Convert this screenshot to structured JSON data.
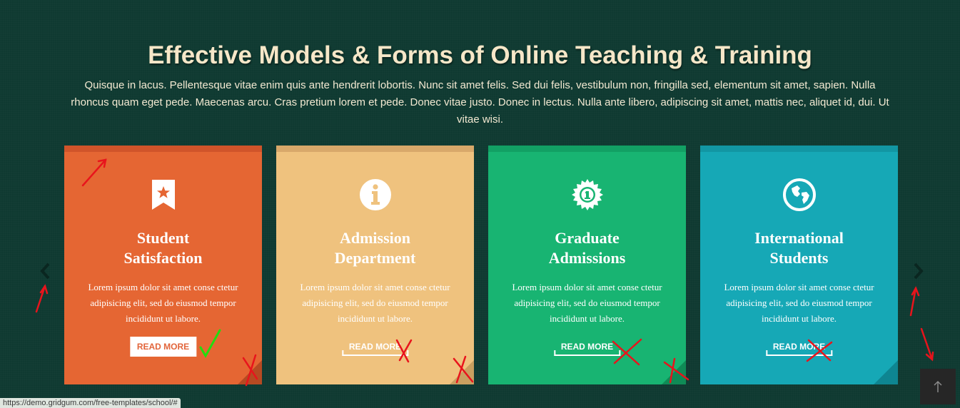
{
  "section": {
    "heading": "Effective Models & Forms of Online Teaching & Training",
    "intro": "Quisque in lacus. Pellentesque vitae enim quis ante hendrerit lobortis. Nunc sit amet felis. Sed dui felis, vestibulum non, fringilla sed, elementum sit amet, sapien. Nulla rhoncus quam eget pede. Maecenas arcu. Cras pretium lorem et pede. Donec vitae justo. Donec in lectus. Nulla ante libero, adipiscing sit amet, mattis nec, aliquet id, dui. Ut vitae wisi."
  },
  "cards": [
    {
      "title_line1": "Student",
      "title_line2": "Satisfaction",
      "desc": "Lorem ipsum dolor sit amet conse ctetur adipisicing elit, sed do eiusmod tempor incididunt ut labore.",
      "button": "READ MORE",
      "icon": "bookmark-star-icon",
      "color": "#e56633",
      "bar_color": "#d0542a"
    },
    {
      "title_line1": "Admission",
      "title_line2": "Department",
      "desc": "Lorem ipsum dolor sit amet conse ctetur adipisicing elit, sed do eiusmod tempor incididunt ut labore.",
      "button": "READ MORE",
      "icon": "info-icon",
      "color": "#efc27e",
      "bar_color": "#d8a86a"
    },
    {
      "title_line1": "Graduate",
      "title_line2": "Admissions",
      "desc": "Lorem ipsum dolor sit amet conse ctetur adipisicing elit, sed do eiusmod tempor incididunt ut labore.",
      "button": "READ MORE",
      "icon": "award-badge-icon",
      "color": "#18b472",
      "bar_color": "#12a064"
    },
    {
      "title_line1": "International",
      "title_line2": "Students",
      "desc": "Lorem ipsum dolor sit amet conse ctetur adipisicing elit, sed do eiusmod tempor incididunt ut labore.",
      "button": "READ MORE",
      "icon": "globe-icon",
      "color": "#16a8b6",
      "bar_color": "#1296a3"
    }
  ],
  "status_url": "https://demo.gridgum.com/free-templates/school/#"
}
